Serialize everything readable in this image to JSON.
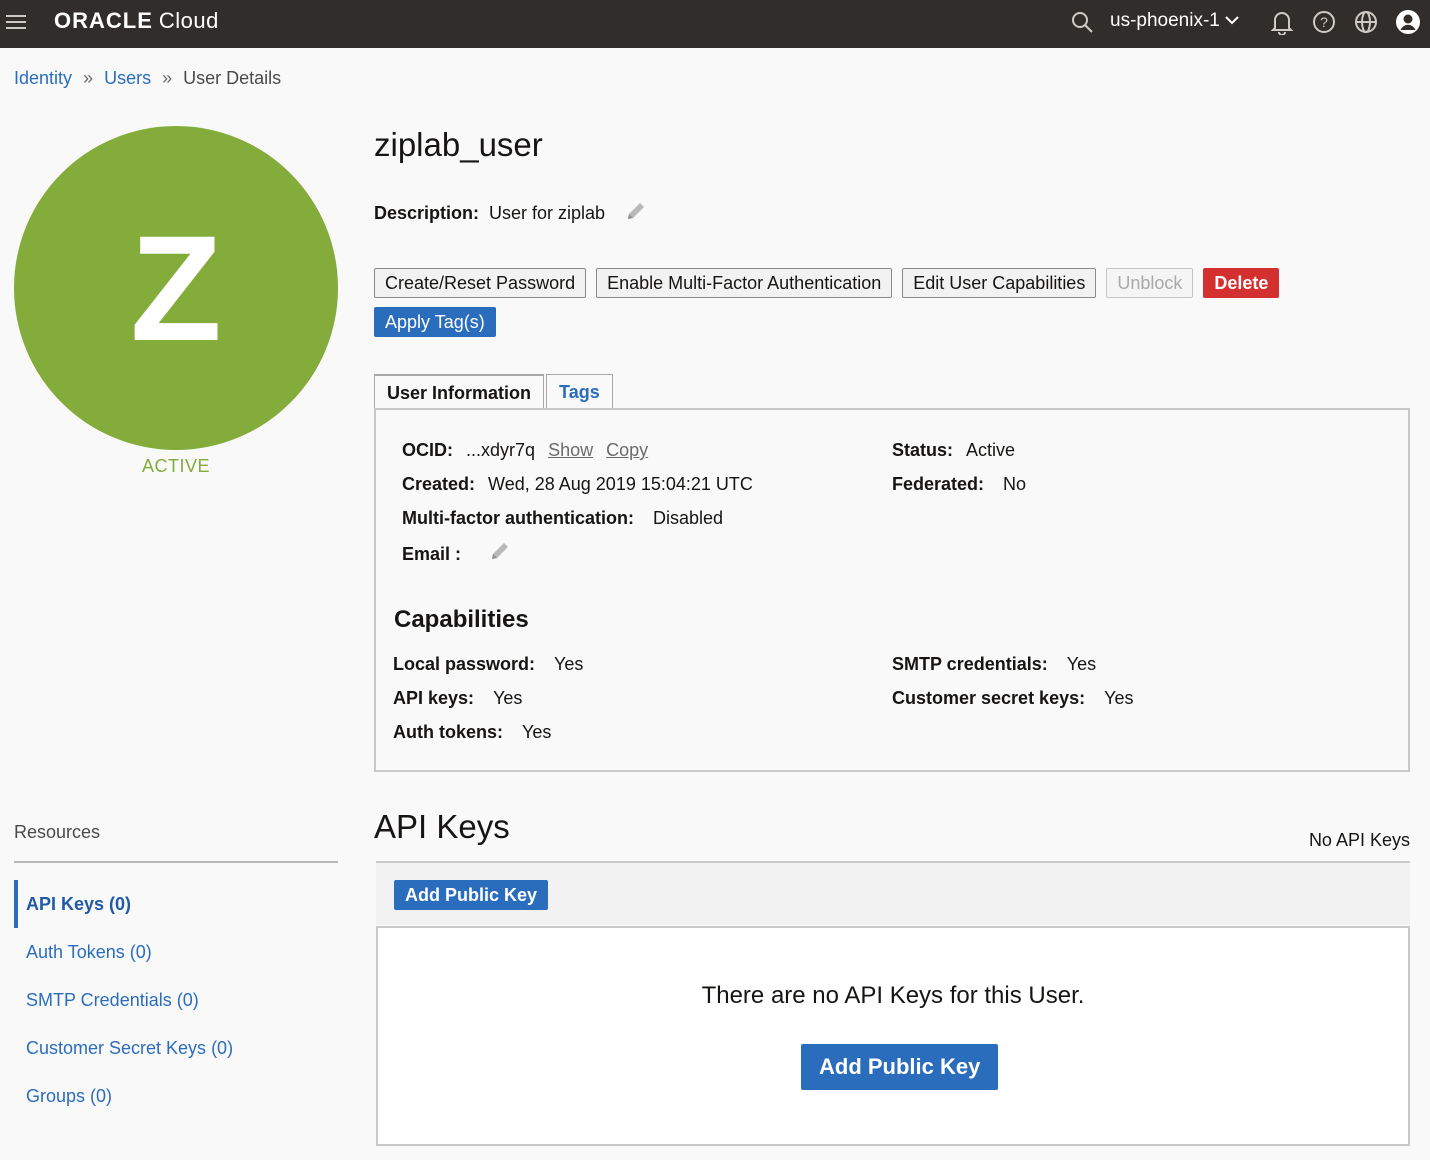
{
  "topbar": {
    "brand_oracle": "ORACLE",
    "brand_cloud": "Cloud",
    "region": "us-phoenix-1"
  },
  "breadcrumb": {
    "identity": "Identity",
    "users": "Users",
    "current": "User Details",
    "separator": "»"
  },
  "avatar": {
    "letter": "Z",
    "status": "ACTIVE",
    "color": "#83ac3a"
  },
  "user": {
    "name": "ziplab_user",
    "description_label": "Description:",
    "description": "User for ziplab"
  },
  "actions": {
    "create_reset_password": "Create/Reset Password",
    "enable_mfa": "Enable Multi-Factor Authentication",
    "edit_capabilities": "Edit User Capabilities",
    "unblock": "Unblock",
    "delete": "Delete",
    "apply_tags": "Apply Tag(s)"
  },
  "tabs": {
    "user_information": "User Information",
    "tags": "Tags"
  },
  "info": {
    "ocid_label": "OCID:",
    "ocid_value": "...xdyr7q",
    "show": "Show",
    "copy": "Copy",
    "created_label": "Created:",
    "created_value": "Wed, 28 Aug 2019 15:04:21 UTC",
    "mfa_label": "Multi-factor authentication:",
    "mfa_value": "Disabled",
    "email_label": "Email :",
    "status_label": "Status:",
    "status_value": "Active",
    "federated_label": "Federated:",
    "federated_value": "No"
  },
  "capabilities": {
    "title": "Capabilities",
    "local_password_label": "Local password:",
    "local_password_value": "Yes",
    "api_keys_label": "API keys:",
    "api_keys_value": "Yes",
    "auth_tokens_label": "Auth tokens:",
    "auth_tokens_value": "Yes",
    "smtp_label": "SMTP credentials:",
    "smtp_value": "Yes",
    "customer_secret_label": "Customer secret keys:",
    "customer_secret_value": "Yes"
  },
  "resources": {
    "title": "Resources",
    "items": [
      {
        "label": "API Keys (0)"
      },
      {
        "label": "Auth Tokens (0)"
      },
      {
        "label": "SMTP Credentials (0)"
      },
      {
        "label": "Customer Secret Keys (0)"
      },
      {
        "label": "Groups (0)"
      }
    ]
  },
  "api_keys": {
    "title": "API Keys",
    "summary": "No API Keys",
    "add_button": "Add Public Key",
    "empty_message": "There are no API Keys for this User.",
    "empty_add_button": "Add Public Key"
  },
  "icons": {
    "menu": "hamburger-menu-icon",
    "search": "search-icon",
    "chevron": "chevron-down-icon",
    "bell": "bell-icon",
    "help": "help-icon",
    "globe": "globe-icon",
    "profile": "user-profile-icon",
    "pencil": "pencil-icon"
  }
}
